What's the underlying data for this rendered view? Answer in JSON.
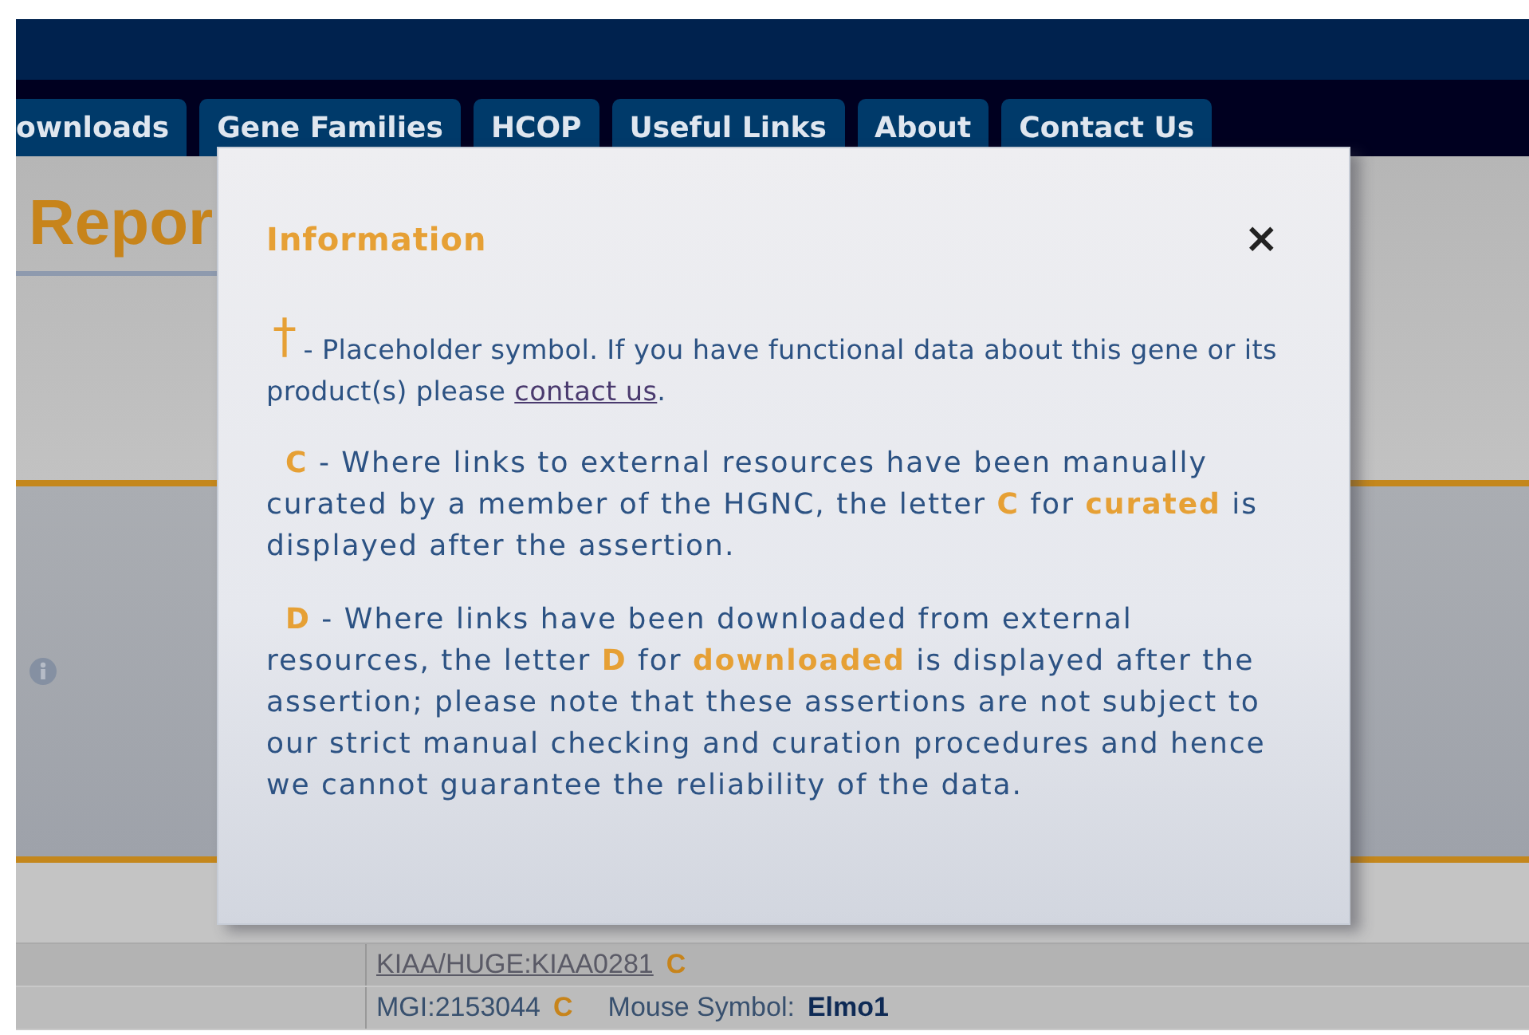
{
  "nav": {
    "tabs": [
      {
        "label": "ownloads"
      },
      {
        "label": "Gene Families"
      },
      {
        "label": "HCOP"
      },
      {
        "label": "Useful Links"
      },
      {
        "label": "About"
      },
      {
        "label": "Contact Us"
      }
    ]
  },
  "page": {
    "heading": "Repor"
  },
  "table": {
    "rows": [
      {
        "items": [
          {
            "kind": "link",
            "text": "KIAA/HUGE:KIAA0281"
          },
          {
            "kind": "flag",
            "text": "C"
          }
        ]
      },
      {
        "items": [
          {
            "kind": "plain",
            "text": "MGI:2153044"
          },
          {
            "kind": "flag",
            "text": "C"
          },
          {
            "kind": "label",
            "text": "Mouse Symbol:"
          },
          {
            "kind": "value",
            "text": "Elmo1"
          }
        ]
      }
    ]
  },
  "modal": {
    "title": "Information",
    "close": "×",
    "notes": [
      {
        "kind": "symbol",
        "symbol": "†",
        "text": "- Placeholder symbol. If you have functional data about this gene or its product(s) please ",
        "link": "contact us",
        "tail": "."
      },
      {
        "kind": "plain",
        "text": "**C** - Where links to external resources have been manually curated by a member of the HGNC, the letter **C** for **curated** is displayed after the assertion."
      },
      {
        "kind": "plain",
        "text": "**D** - Where links have been downloaded from external resources, the letter **D** for **downloaded** is displayed after the assertion; please note that these assertions are not subject to our strict manual checking and curation procedures and hence we cannot guarantee the reliability of the data."
      }
    ]
  }
}
